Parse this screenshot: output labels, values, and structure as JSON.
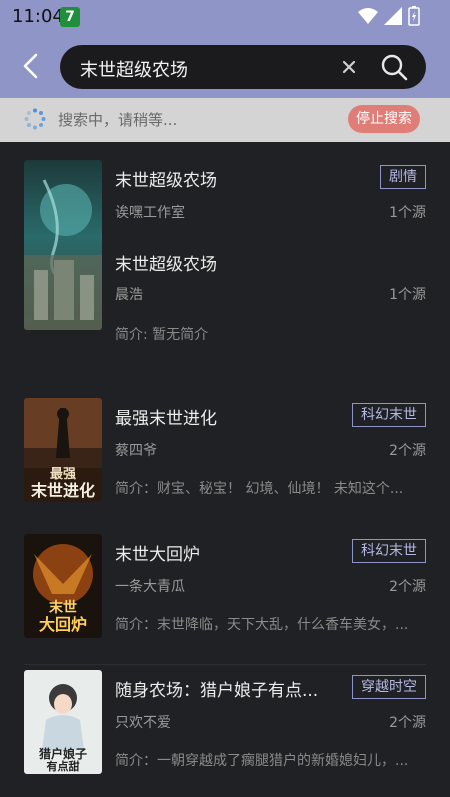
{
  "status": {
    "time": "11:04",
    "notif_badge": "7"
  },
  "search": {
    "query": "末世超级农场"
  },
  "loading": {
    "text": "搜索中，请稍等...",
    "stop_label": "停止搜索"
  },
  "colors": {
    "accent": "#8f95c7",
    "stop": "#e07d77",
    "bg": "#202124"
  },
  "books": [
    {
      "title": "末世超级农场",
      "author": "诶嘿工作室",
      "sources": "1个源",
      "tag": "剧情",
      "intro": ""
    },
    {
      "title": "末世超级农场",
      "author": "晨浩",
      "sources": "1个源",
      "tag": "",
      "intro": "简介: 暂无简介"
    },
    {
      "title": "最强末世进化",
      "author": "蔡四爷",
      "sources": "2个源",
      "tag": "科幻末世",
      "intro": "简介：财宝、秘宝！ 幻境、仙境！ 未知这个..."
    },
    {
      "title": "末世大回炉",
      "author": "一条大青瓜",
      "sources": "2个源",
      "tag": "科幻末世",
      "intro": "简介：末世降临，天下大乱，什么香车美女，..."
    },
    {
      "title": "随身农场：猎户娘子有点...",
      "author": "只欢不爱",
      "sources": "2个源",
      "tag": "穿越时空",
      "intro": "简介：一朝穿越成了瘸腿猎户的新婚媳妇儿，..."
    }
  ]
}
